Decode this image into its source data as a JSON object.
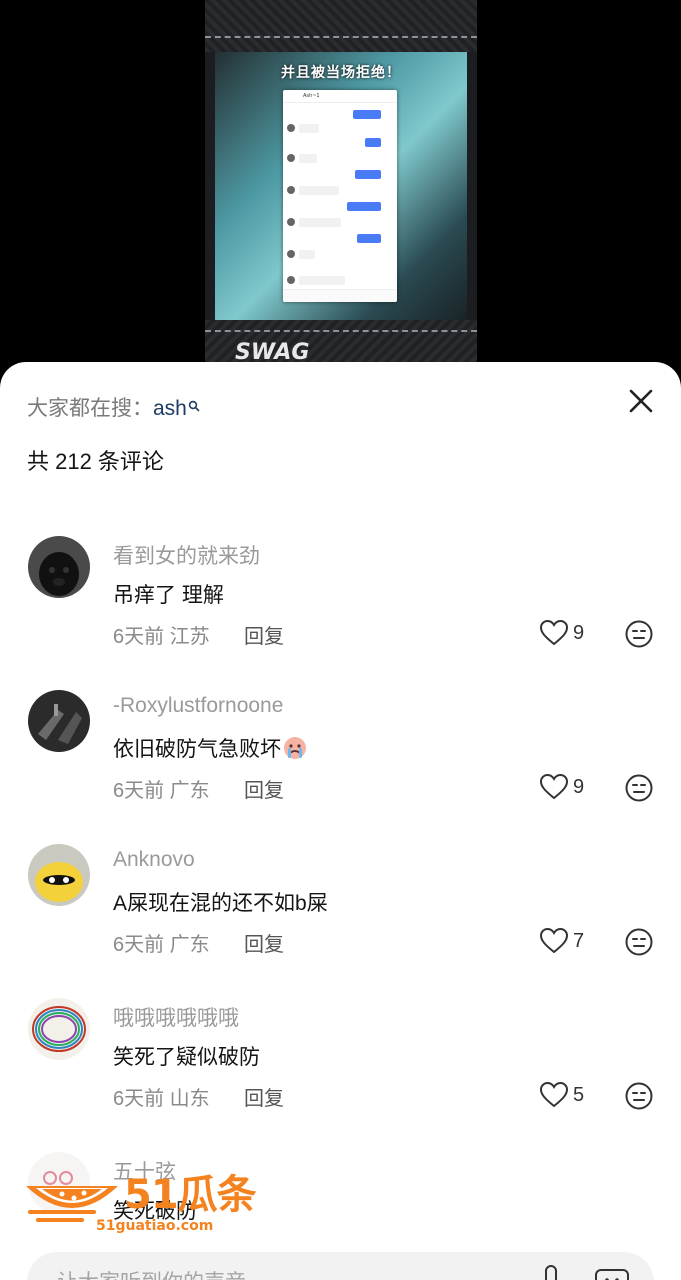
{
  "video": {
    "caption": "并且被当场拒绝！",
    "chat_title": "Ash~1",
    "swag_text": "SWAG"
  },
  "sheet": {
    "search_hint_prefix": "大家都在搜：",
    "search_keyword": "ash",
    "comment_count_label": "共 212 条评论",
    "reply_label": "回复",
    "input_placeholder": "让大家听到你的声音"
  },
  "comments": [
    {
      "user": "看到女的就来劲",
      "text": "吊痒了 理解",
      "meta": "6天前 江苏",
      "likes": "9",
      "avatar": "black-dog"
    },
    {
      "user": "-Roxylustfornoone",
      "text": "依旧破防气急败坏",
      "emoji": "crying-face",
      "meta": "6天前 广东",
      "likes": "9",
      "avatar": "hands-dark"
    },
    {
      "user": "Anknovo",
      "text": "A屎现在混的还不如b屎",
      "meta": "6天前 广东",
      "likes": "7",
      "avatar": "yellow-character"
    },
    {
      "user": "哦哦哦哦哦哦",
      "text": "笑死了疑似破防",
      "meta": "6天前 山东",
      "likes": "5",
      "avatar": "colorful-circle"
    },
    {
      "user": "五十弦",
      "text": "笑死破防",
      "meta": "",
      "likes": "",
      "avatar": "pink-doodle"
    }
  ],
  "watermark": {
    "brand": "51瓜条",
    "url": "51guatiao.com",
    "color": "#f4821f"
  },
  "icons": {
    "close": "close-icon",
    "like": "heart-outline-icon",
    "dislike": "meh-face-icon",
    "search": "search-icon",
    "mic": "mic-icon",
    "emoji": "emoji-icon"
  }
}
